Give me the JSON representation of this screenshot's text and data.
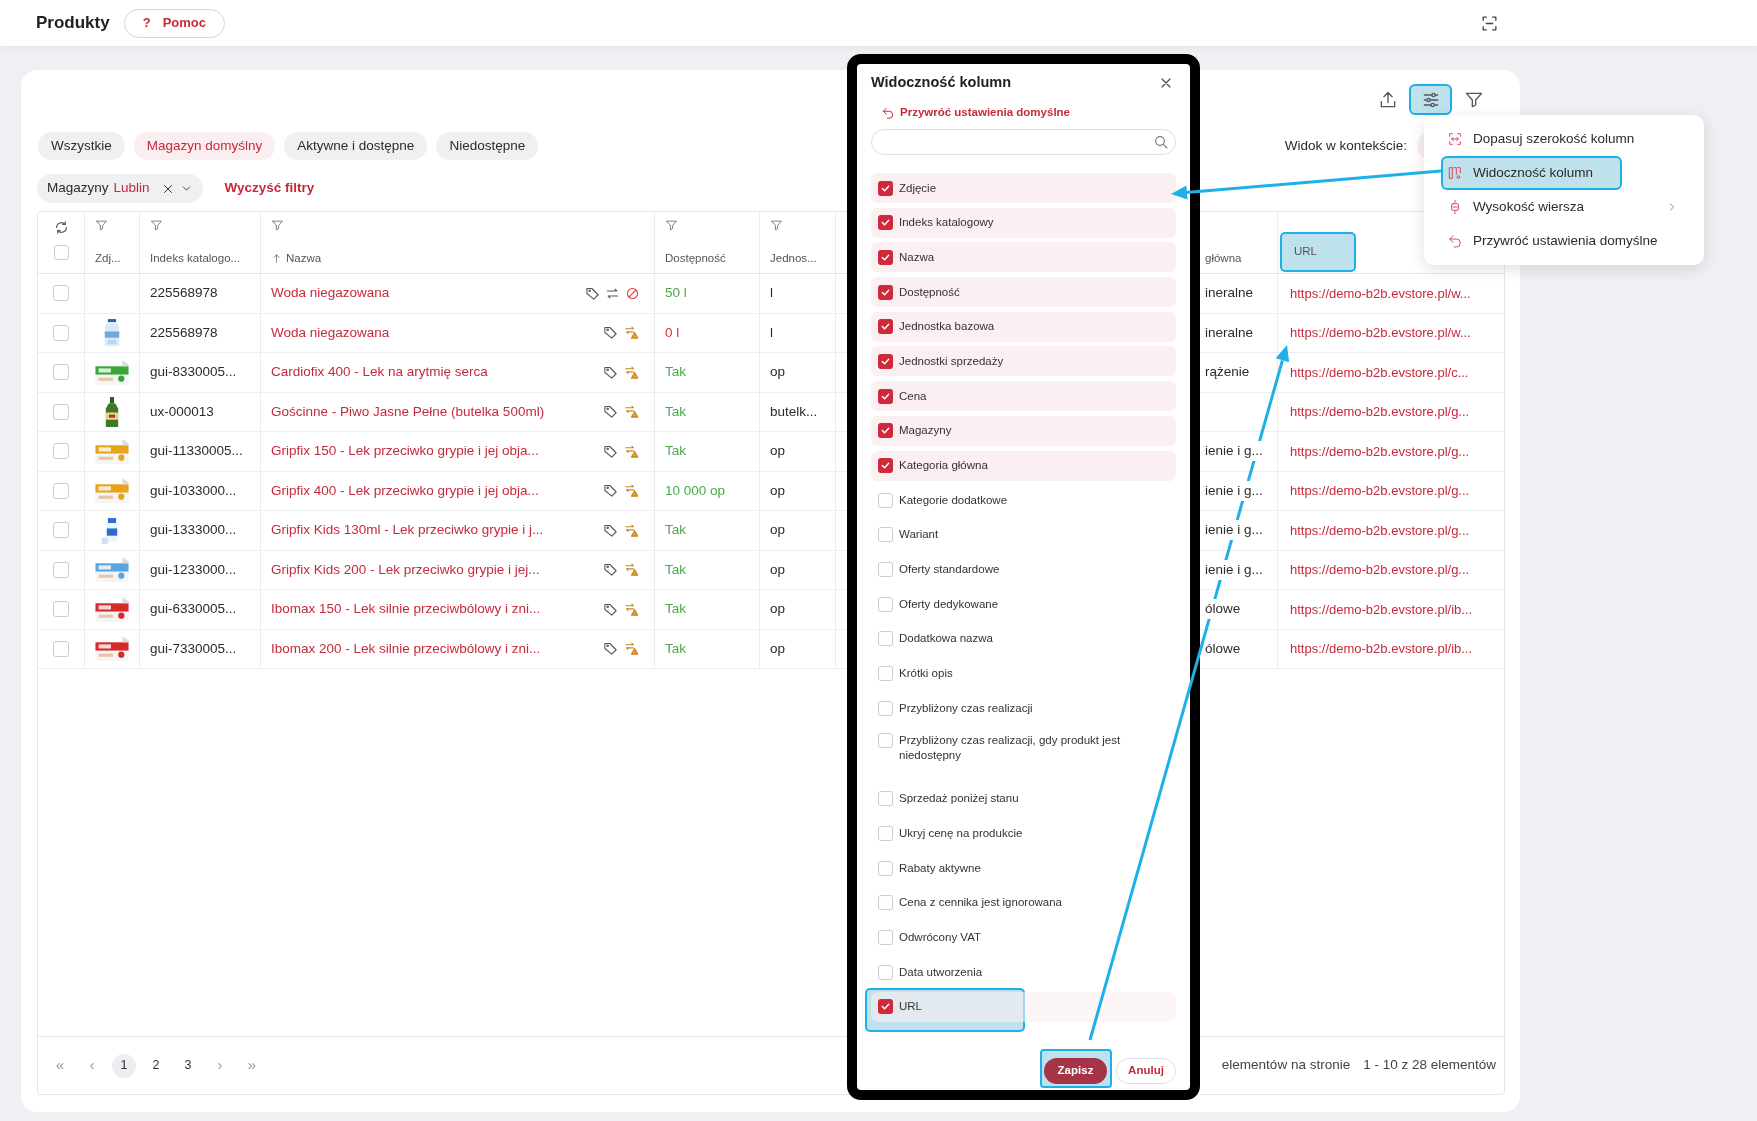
{
  "header": {
    "title": "Produkty",
    "help_button": {
      "icon": "?",
      "label": "Pomoc"
    }
  },
  "toolbar": [
    {
      "kind": "export",
      "highlighted": false
    },
    {
      "kind": "columns",
      "highlighted": true
    },
    {
      "kind": "filter",
      "highlighted": false
    }
  ],
  "tabs": [
    {
      "label": "Wszystkie",
      "selected": false
    },
    {
      "label": "Magazyn domyślny",
      "selected": true
    },
    {
      "label": "Aktywne i dostępne",
      "selected": false
    },
    {
      "label": "Niedostępne",
      "selected": false
    }
  ],
  "context_view": {
    "label": "Widok w kontekście:"
  },
  "filters": {
    "chips": [
      {
        "name": "Magazyny",
        "value": "Lublin"
      }
    ],
    "clear": "Wyczyść filtry"
  },
  "table": {
    "columns": [
      {
        "kind": "select",
        "checked": false
      },
      {
        "label": "Zdj...",
        "filter": true
      },
      {
        "label": "Indeks katalogo...",
        "filter": true
      },
      {
        "label": "Nazwa",
        "filter": true,
        "sorted": true
      },
      {
        "label": "Dostępność",
        "filter": true
      },
      {
        "label": "Jednos...",
        "filter": true
      },
      {
        "label": "główna",
        "filter": false
      },
      {
        "label": "URL",
        "filter": false,
        "highlighted": true
      }
    ],
    "rows": [
      {
        "checked": false,
        "index": "225568978",
        "name": "Woda niegazowana",
        "blocked": true,
        "availability": "50 l",
        "in_stock": true,
        "unit": "l",
        "category": "ineralne",
        "url": "https://demo-b2b.evstore.pl/w..."
      },
      {
        "checked": false,
        "index": "225568978",
        "name": "Woda niegazowana",
        "blocked": false,
        "availability": "0 l",
        "in_stock": false,
        "unit": "l",
        "category": "ineralne",
        "url": "https://demo-b2b.evstore.pl/w..."
      },
      {
        "checked": false,
        "index": "gui-8330005...",
        "name": "Cardiofix 400 - Lek na arytmię serca",
        "blocked": false,
        "availability": "Tak",
        "in_stock": true,
        "unit": "op",
        "category": "rążenie",
        "url": "https://demo-b2b.evstore.pl/c..."
      },
      {
        "checked": false,
        "index": "ux-000013",
        "name": "Gościnne - Piwo Jasne Pełne (butelka 500ml)",
        "blocked": false,
        "availability": "Tak",
        "in_stock": true,
        "unit": "butelk...",
        "url": "https://demo-b2b.evstore.pl/g..."
      },
      {
        "checked": false,
        "index": "gui-11330005...",
        "name": "Gripfix 150 - Lek przeciwko grypie i jej obja...",
        "blocked": false,
        "availability": "Tak",
        "in_stock": true,
        "unit": "op",
        "category": "ienie i g...",
        "url": "https://demo-b2b.evstore.pl/g..."
      },
      {
        "checked": false,
        "index": "gui-1033000...",
        "name": "Gripfix 400 - Lek przeciwko grypie i jej obja...",
        "blocked": false,
        "availability": "10 000 op",
        "in_stock": true,
        "unit": "op",
        "category": "ienie i g...",
        "url": "https://demo-b2b.evstore.pl/g..."
      },
      {
        "checked": false,
        "index": "gui-1333000...",
        "name": "Gripfix Kids 130ml - Lek przeciwko grypie i j...",
        "blocked": false,
        "availability": "Tak",
        "in_stock": true,
        "unit": "op",
        "category": "ienie i g...",
        "url": "https://demo-b2b.evstore.pl/g..."
      },
      {
        "checked": false,
        "index": "gui-1233000...",
        "name": "Gripfix Kids 200 - Lek przeciwko grypie i jej...",
        "blocked": false,
        "availability": "Tak",
        "in_stock": true,
        "unit": "op",
        "category": "ienie i g...",
        "url": "https://demo-b2b.evstore.pl/g..."
      },
      {
        "checked": false,
        "index": "gui-6330005...",
        "name": "Ibomax 150 - Lek silnie przeciwbólowy i zni...",
        "blocked": false,
        "availability": "Tak",
        "in_stock": true,
        "unit": "op",
        "category": "ólowe",
        "url": "https://demo-b2b.evstore.pl/ib..."
      },
      {
        "checked": false,
        "index": "gui-7330005...",
        "name": "Ibomax 200 - Lek silnie przeciwbólowy i zni...",
        "blocked": false,
        "availability": "Tak",
        "in_stock": true,
        "unit": "op",
        "category": "ólowe",
        "url": "https://demo-b2b.evstore.pl/ib..."
      }
    ]
  },
  "pagination": {
    "first": "«",
    "prev": "‹",
    "pages": [
      {
        "label": "1",
        "selected": true
      },
      {
        "label": "2",
        "selected": false
      },
      {
        "label": "3",
        "selected": false
      }
    ],
    "next": "›",
    "last": "»",
    "per_page_label": "elementów na stronie",
    "range": "1 - 10 z 28 elementów"
  },
  "menu": {
    "items": [
      {
        "kind": "fit",
        "label": "Dopasuj szerokość kolumn",
        "highlighted": false,
        "submenu": false
      },
      {
        "kind": "visibility",
        "label": "Widoczność kolumn",
        "highlighted": true,
        "submenu": false
      },
      {
        "kind": "row_height",
        "label": "Wysokość wiersza",
        "highlighted": false,
        "submenu": true
      },
      {
        "kind": "reset",
        "label": "Przywróć ustawienia domyślne",
        "highlighted": false,
        "submenu": false
      }
    ]
  },
  "modal": {
    "title": "Widoczność kolumn",
    "restore": "Przywróć ustawienia domyślne",
    "options": [
      {
        "label": "Zdjęcie",
        "checked": true,
        "highlighted": false
      },
      {
        "label": "Indeks katalogowy",
        "checked": true,
        "highlighted": false
      },
      {
        "label": "Nazwa",
        "checked": true,
        "highlighted": false
      },
      {
        "label": "Dostępność",
        "checked": true,
        "highlighted": false
      },
      {
        "label": "Jednostka bazowa",
        "checked": true,
        "highlighted": false
      },
      {
        "label": "Jednostki sprzedaży",
        "checked": true,
        "highlighted": false
      },
      {
        "label": "Cena",
        "checked": true,
        "highlighted": false
      },
      {
        "label": "Magazyny",
        "checked": true,
        "highlighted": false
      },
      {
        "label": "Kategoria główna",
        "checked": true,
        "highlighted": false
      },
      {
        "label": "Kategorie dodatkowe",
        "checked": false,
        "highlighted": false
      },
      {
        "label": "Wariant",
        "checked": false,
        "highlighted": false
      },
      {
        "label": "Oferty standardowe",
        "checked": false,
        "highlighted": false
      },
      {
        "label": "Oferty dedykowane",
        "checked": false,
        "highlighted": false
      },
      {
        "label": "Dodatkowa nazwa",
        "checked": false,
        "highlighted": false
      },
      {
        "label": "Krótki opis",
        "checked": false,
        "highlighted": false
      },
      {
        "label": "Przybliżony czas realizacji",
        "checked": false,
        "highlighted": false
      },
      {
        "label": "Przybliżony czas realizacji, gdy produkt jest niedostępny",
        "checked": false,
        "highlighted": false
      },
      {
        "label": "Sprzedaż poniżej stanu",
        "checked": false,
        "highlighted": false
      },
      {
        "label": "Ukryj cenę na produkcie",
        "checked": false,
        "highlighted": false
      },
      {
        "label": "Rabaty aktywne",
        "checked": false,
        "highlighted": false
      },
      {
        "label": "Cena z cennika jest ignorowana",
        "checked": false,
        "highlighted": false
      },
      {
        "label": "Odwrócony VAT",
        "checked": false,
        "highlighted": false
      },
      {
        "label": "Data utworzenia",
        "checked": false,
        "highlighted": false
      },
      {
        "label": "URL",
        "checked": true,
        "highlighted": true
      }
    ],
    "buttons": [
      {
        "kind": "primary",
        "label": "Zapisz",
        "highlighted": true
      },
      {
        "kind": "secondary",
        "label": "Anuluj",
        "highlighted": false
      }
    ]
  }
}
